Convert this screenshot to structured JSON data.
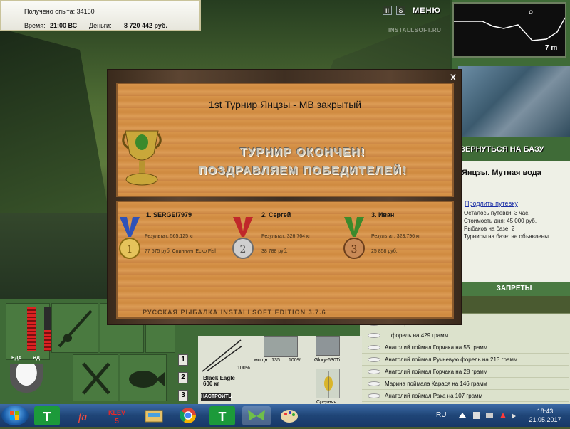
{
  "info": {
    "experience_label": "Получено опыта: 34150",
    "time_label": "Время:",
    "time_value": "21:00 ВС",
    "money_label": "Деньги:",
    "money_value": "8 720 442 руб."
  },
  "topbar": {
    "pause_label": "II",
    "s_label": "S",
    "menu_label": "МЕНЮ",
    "watermark": "INSTALLSOFT.RU"
  },
  "depth": {
    "value": "7 m"
  },
  "right_panel": {
    "back_to_base": "ВЕРНУТЬСЯ НА БАЗУ",
    "lake_name": "Янцзы. Мутная вода",
    "extend_trip": "Продлить путевку",
    "trip_left": "Осталось путевки: 3 час.",
    "day_cost": "Стоимость дня: 45 000 руб.",
    "fishers": "Рыбаков на базе: 2",
    "tournaments": "Турниры на базе: не объявлены",
    "bans": "ЗАПРЕТЫ"
  },
  "log": [
    "... 148 грамм",
    "... форель на 429 грамм",
    "Анатолий поймал Горчака на 55 грамм",
    "Анатолий поймал Ручьевую форель на 213 грамм",
    "Анатолий поймал Горчака на 28 грамм",
    "Марина поймала Карася на 146 грамм",
    "Анатолий поймал Рака на 107 грамм"
  ],
  "controls": {
    "food_label": "ЕДА",
    "energy_label": "ЯД",
    "slot1": "1",
    "slot2": "2",
    "slot3": "3",
    "rod_name": "Black Eagle",
    "rod_weight": "600 кг",
    "setup_label": "НАСТРОИТЬ",
    "pct_rod": "100%",
    "power_label": "мощн.: 135",
    "pct_reel": "100%",
    "reel_name": "Glory-630Ti",
    "lure_label": "Средняя"
  },
  "dialog": {
    "close": "X",
    "title": "1st Турнир Янцзы - МВ закрытый",
    "line1": "ТУРНИР ОКОНЧЕН!",
    "line2": "ПОЗДРАВЛЯЕМ ПОБЕДИТЕЛЕЙ!",
    "edition": "РУССКАЯ РЫБАЛКА INSTALLSOFT EDITION 3.7.6",
    "winners": [
      {
        "name": "1. SERGEI7979",
        "result": "Результат: 565,125 кг",
        "prize": "77 575 руб. Спиннинг Ecko Fish",
        "medal_color": "#2f52b8",
        "medal_number": "1"
      },
      {
        "name": "2. Сергей",
        "result": "Результат: 326,764 кг",
        "prize": "38 788 руб.",
        "medal_color": "#c0282a",
        "medal_number": "2"
      },
      {
        "name": "3. Иван",
        "result": "Результат: 323,796 кг",
        "prize": "25 858 руб.",
        "medal_color": "#3c8a2c",
        "medal_number": "3"
      }
    ]
  },
  "taskbar": {
    "lang": "RU",
    "time": "18:43",
    "date": "21.05.2017"
  }
}
